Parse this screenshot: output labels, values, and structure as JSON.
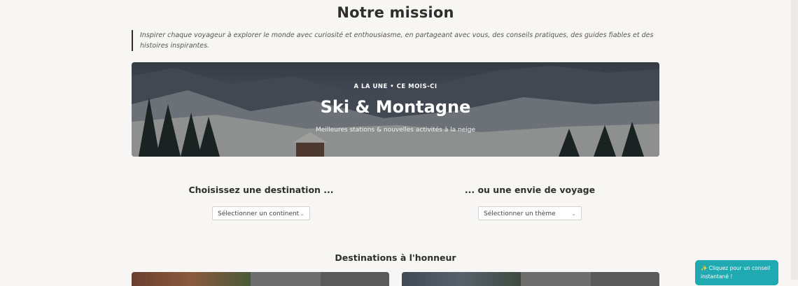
{
  "mission": {
    "title": "Notre mission",
    "quote": "Inspirer chaque voyageur à explorer le monde avec curiosité et enthousiasme, en partageant avec vous, des conseils pratiques, des guides fiables et des histoires inspirantes."
  },
  "hero": {
    "kicker": "A LA UNE • CE MOIS-CI",
    "title": "Ski & Montagne",
    "subtitle": "Meilleures stations & nouvelles activités à la neige"
  },
  "filters": {
    "destination": {
      "title": "Choisissez une destination ...",
      "selected": "Sélectionner un continent"
    },
    "envie": {
      "title": "... ou une envie de voyage",
      "selected": "Sélectionner un thème"
    }
  },
  "featured": {
    "title": "Destinations à l'honneur"
  },
  "chat": {
    "label": "✨ Cliquez pour un conseil instantané !"
  }
}
